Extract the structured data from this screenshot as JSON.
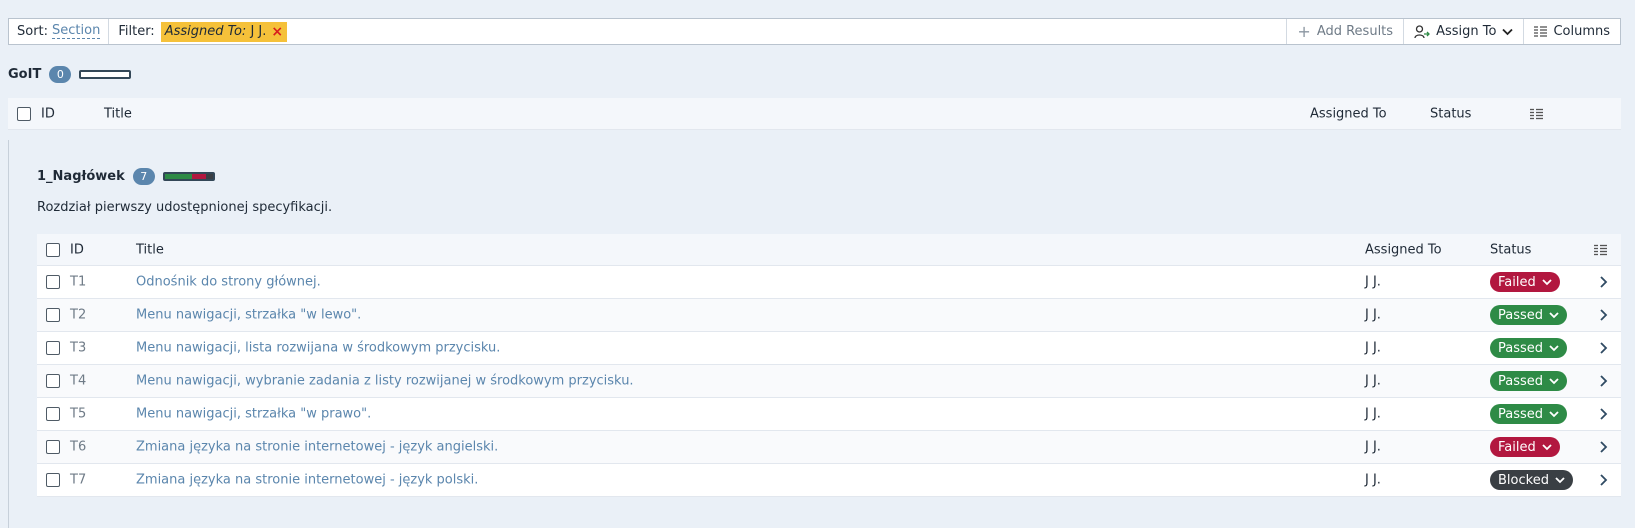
{
  "toolbar": {
    "sort_label": "Sort:",
    "sort_value": "Section",
    "filter_label": "Filter:",
    "filter_chip_key": "Assigned To:",
    "filter_chip_value": "J J.",
    "filter_chip_remove": "×",
    "add_results": "Add Results",
    "assign_to": "Assign To",
    "columns": "Columns"
  },
  "colors": {
    "passed": "#2e8b46",
    "failed": "#b2173f",
    "blocked": "#3a3f44",
    "link": "#5b86ad",
    "filter_chip": "#f5c13a"
  },
  "sections": [
    {
      "name": "GoIT",
      "count": "0",
      "columns": [
        "ID",
        "Title",
        "Assigned To",
        "Status"
      ],
      "progress": {
        "passed": 0,
        "failed": 0,
        "blocked": 0,
        "untested": 1
      }
    },
    {
      "name": "1_Nagłówek",
      "count": "7",
      "description": "Rozdział pierwszy udostępnionej specyfikacji.",
      "columns": [
        "ID",
        "Title",
        "Assigned To",
        "Status"
      ],
      "progress": {
        "passed": 0.57,
        "failed": 0.29,
        "blocked": 0.14,
        "untested": 0
      },
      "rows": [
        {
          "id": "T1",
          "title": "Odnośnik do strony głównej.",
          "assigned": "J J.",
          "status": "Failed"
        },
        {
          "id": "T2",
          "title": "Menu nawigacji, strzałka \"w lewo\".",
          "assigned": "J J.",
          "status": "Passed"
        },
        {
          "id": "T3",
          "title": "Menu nawigacji, lista rozwijana w środkowym przycisku.",
          "assigned": "J J.",
          "status": "Passed"
        },
        {
          "id": "T4",
          "title": "Menu nawigacji, wybranie zadania z listy rozwijanej w środkowym przycisku.",
          "assigned": "J J.",
          "status": "Passed"
        },
        {
          "id": "T5",
          "title": "Menu nawigacji, strzałka \"w prawo\".",
          "assigned": "J J.",
          "status": "Passed"
        },
        {
          "id": "T6",
          "title": "Zmiana języka na stronie internetowej - język angielski.",
          "assigned": "J J.",
          "status": "Failed"
        },
        {
          "id": "T7",
          "title": "Zmiana języka na stronie internetowej - język polski.",
          "assigned": "J J.",
          "status": "Blocked"
        }
      ]
    }
  ]
}
